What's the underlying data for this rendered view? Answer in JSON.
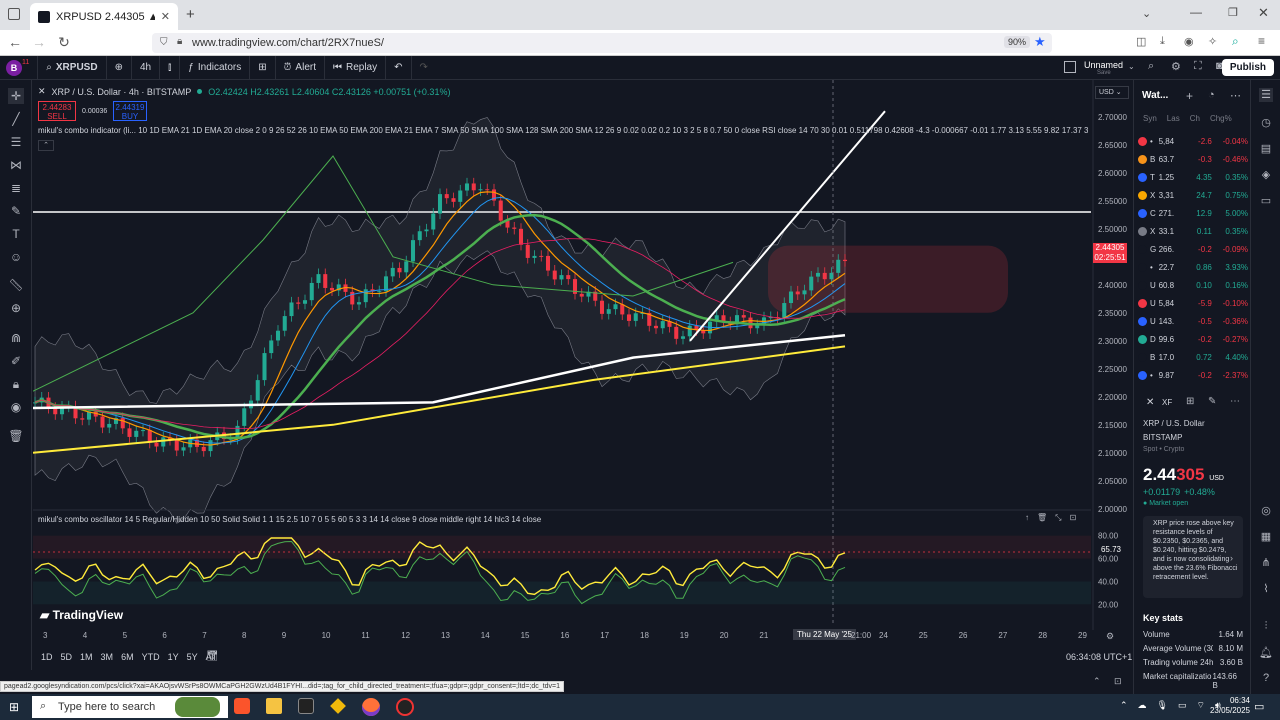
{
  "browser": {
    "tab_title": "XRPUSD 2.44305 ▲ +0.48% Un",
    "url": "www.tradingview.com/chart/2RX7nueS/",
    "zoom": "90%"
  },
  "toolbar": {
    "avatar_letter": "B",
    "avatar_badge": "11",
    "symbol": "XRPUSD",
    "interval": "4h",
    "indicators": "Indicators",
    "alert": "Alert",
    "replay": "Replay",
    "layout_name": "Unnamed",
    "layout_sub": "Save",
    "publish": "Publish"
  },
  "chart": {
    "legend_title": "XRP / U.S. Dollar · 4h · BITSTAMP",
    "ohlc": "O2.42424 H2.43261 L2.40604 C2.43126 +0.00751 (+0.31%)",
    "sell_price": "2.44283",
    "sell_label": "SELL",
    "spread": "0.00036",
    "buy_price": "2.44319",
    "buy_label": "BUY",
    "indicator_text": "mikul's combo indicator (li... 10 1D EMA 21 1D EMA 20 close 2 0 9 26 52 26 10 EMA 50 EMA 200 EMA 21 EMA 7 SMA 50 SMA 100 SMA 128 SMA 200 SMA 12 26 9 0.02 0.02 0.2 10 3 2 5 8 0.7 50 0 close RSI close 14 70 30 0.01 0.511798 0.42608 -4.3 -0.000667 -0.01 1.77 3.13 5.55 9.82 17.37 30.75 ...",
    "oscillator_text": "mikul's combo oscillator 14 5 Regular/Hidden 10 50 Solid Solid 1 1 15 2.5 10 7 0 5 5 60 5 3 3 14 14 close 9 close middle right 14 hlc3 14 close",
    "currency": "USD",
    "price_label_top": "2.44305",
    "price_label_bottom": "02:25:51",
    "osc_value": "65.73",
    "logo": "TradingView",
    "crosshair_date": "Thu 22 May '25",
    "crosshair_time": "21:00",
    "price_ticks": [
      "2.70000",
      "2.65000",
      "2.60000",
      "2.55000",
      "2.50000",
      "2.45000",
      "2.40000",
      "2.35000",
      "2.30000",
      "2.25000",
      "2.20000",
      "2.15000",
      "2.10000",
      "2.05000",
      "2.00000"
    ],
    "osc_ticks": [
      "80.00",
      "60.00",
      "40.00",
      "20.00"
    ],
    "time_ticks": [
      "3",
      "4",
      "5",
      "6",
      "7",
      "8",
      "9",
      "10",
      "11",
      "12",
      "13",
      "14",
      "15",
      "16",
      "17",
      "18",
      "19",
      "20",
      "21",
      "24",
      "25",
      "26",
      "27",
      "28",
      "29"
    ],
    "ranges": [
      "1D",
      "5D",
      "1M",
      "3M",
      "6M",
      "YTD",
      "1Y",
      "5Y",
      "All"
    ],
    "utc": "06:34:08 UTC+1"
  },
  "chart_data": {
    "type": "line",
    "title": "XRP / U.S. Dollar · 4h · BITSTAMP",
    "x": [
      "3",
      "4",
      "5",
      "6",
      "7",
      "8",
      "9",
      "10",
      "11",
      "12",
      "13",
      "14",
      "15",
      "16",
      "17",
      "18",
      "19",
      "20",
      "21",
      "22",
      "23"
    ],
    "series": [
      {
        "name": "XRPUSD",
        "values": [
          2.19,
          2.17,
          2.15,
          2.12,
          2.11,
          2.14,
          2.33,
          2.41,
          2.37,
          2.43,
          2.55,
          2.58,
          2.47,
          2.41,
          2.36,
          2.34,
          2.31,
          2.34,
          2.33,
          2.4,
          2.44
        ]
      }
    ],
    "ylim": [
      1.98,
      2.73
    ]
  },
  "watchlist": {
    "title": "Wat...",
    "columns": [
      "Syn",
      "Las",
      "Ch",
      "Chg%"
    ],
    "rows": [
      {
        "sym": "•",
        "last": "5,84",
        "chg": "-2.6",
        "chp": "-0.04%",
        "color": "#f23645",
        "pos": false
      },
      {
        "sym": "B",
        "last": "63.7",
        "chg": "-0.3",
        "chp": "-0.46%",
        "color": "#f7931a",
        "pos": false
      },
      {
        "sym": "T",
        "last": "1.25",
        "chg": "4.35",
        "chp": "0.35%",
        "color": "#2962ff",
        "pos": true
      },
      {
        "sym": "X",
        "last": "3,31",
        "chg": "24.7",
        "chp": "0.75%",
        "color": "#f7a600",
        "pos": true
      },
      {
        "sym": "C",
        "last": "271.",
        "chg": "12.9",
        "chp": "5.00%",
        "color": "#2962ff",
        "pos": true
      },
      {
        "sym": "X",
        "last": "33.1",
        "chg": "0.11",
        "chp": "0.35%",
        "color": "#787b86",
        "pos": true
      },
      {
        "sym": "G",
        "last": "266.",
        "chg": "-0.2",
        "chp": "-0.09%",
        "color": "#131722",
        "pos": false
      },
      {
        "sym": "•",
        "last": "22.7",
        "chg": "0.86",
        "chp": "3.93%",
        "color": "#131722",
        "pos": true
      },
      {
        "sym": "U",
        "last": "60.8",
        "chg": "0.10",
        "chp": "0.16%",
        "color": "#131722",
        "pos": true
      },
      {
        "sym": "U",
        "last": "5,84",
        "chg": "-5.9",
        "chp": "-0.10%",
        "color": "#f23645",
        "pos": false
      },
      {
        "sym": "U",
        "last": "143.",
        "chg": "-0.5",
        "chp": "-0.36%",
        "color": "#2962ff",
        "pos": false
      },
      {
        "sym": "D",
        "last": "99.6",
        "chg": "-0.2",
        "chp": "-0.27%",
        "color": "#22ab94",
        "pos": false
      },
      {
        "sym": "B",
        "last": "17.0",
        "chg": "0.72",
        "chp": "4.40%",
        "color": "#131722",
        "pos": true
      },
      {
        "sym": "•",
        "last": "9.87",
        "chg": "-0.2",
        "chp": "-2.37%",
        "color": "#2962ff",
        "pos": false
      }
    ]
  },
  "detail": {
    "symbol_short": "XF",
    "name": "XRP / U.S. Dollar",
    "exchange": "BITSTAMP",
    "type": "Spot • Crypto",
    "price_main": "2.44",
    "price_tail": "305",
    "currency": "USD",
    "change": "+0.01179",
    "change_pct": "+0.48%",
    "market": "Market open",
    "news": "XRP price rose above key resistance levels of $0.2350, $0.2365, and $0.240, hitting $0.2479, and is now consolidating above the 23.6% Fibonacci retracement level.",
    "key_stats_title": "Key stats",
    "stats": [
      {
        "label": "Volume",
        "value": "1.64 M"
      },
      {
        "label": "Average Volume (30D)",
        "value": "8.10 M"
      },
      {
        "label": "Trading volume 24h",
        "value": "3.60 B"
      },
      {
        "label": "Market capitalization",
        "value": "143.66 B"
      }
    ]
  },
  "statusbar": "pagead2.googlesyndication.com/pcs/click?xai=AKAOjsvWSrPs8OWMCaPGH2GWzUd4B1FYHI...did=;tag_for_child_directed_treatment=;tfua=;gdpr=;gdpr_consent=;ltd=;dc_tdv=1",
  "taskbar": {
    "search_placeholder": "Type here to search",
    "time": "06:34",
    "date": "23/05/2025"
  }
}
